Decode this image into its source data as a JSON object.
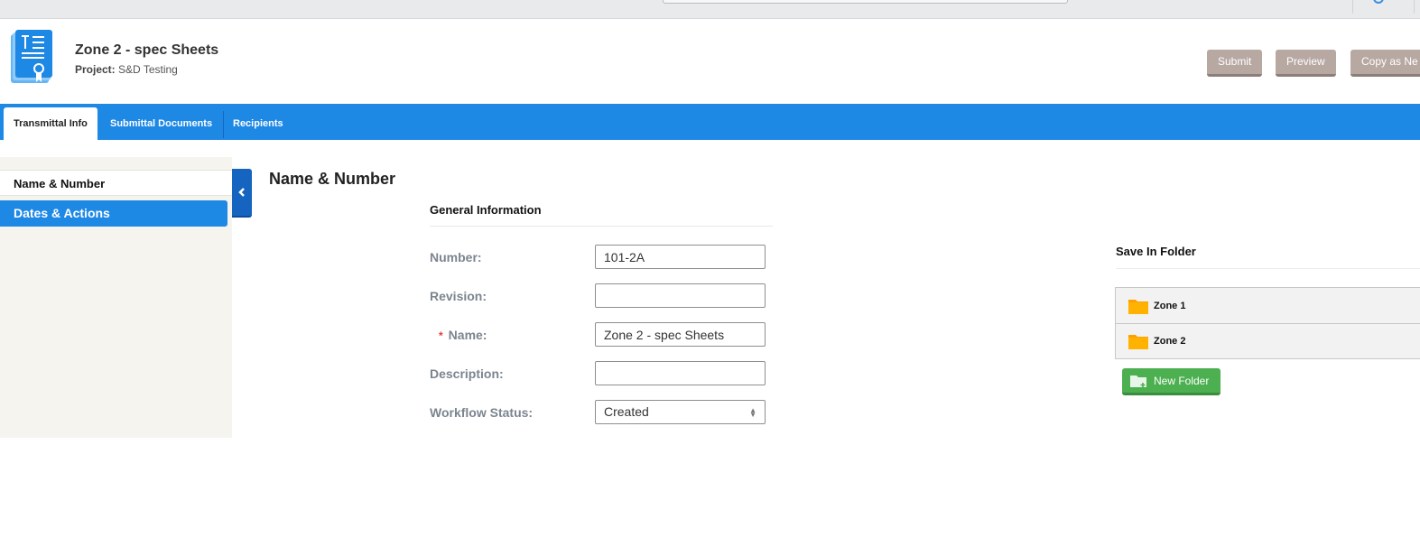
{
  "header": {
    "title": "Zone 2 - spec Sheets",
    "project_label": "Project:",
    "project_value": "S&D Testing",
    "buttons": {
      "submit": "Submit",
      "preview": "Preview",
      "copy": "Copy as Ne"
    }
  },
  "tabs": [
    {
      "label": "Transmittal Info",
      "active": true
    },
    {
      "label": "Submittal Documents",
      "active": false
    },
    {
      "label": "Recipients",
      "active": false
    }
  ],
  "sidebar": {
    "items": [
      {
        "label": "Name & Number",
        "active": false
      },
      {
        "label": "Dates & Actions",
        "active": true
      }
    ]
  },
  "main": {
    "section_title": "Name & Number",
    "general_info_title": "General Information",
    "fields": [
      {
        "label": "Number:",
        "value": "101-2A",
        "required": false
      },
      {
        "label": "Revision:",
        "value": "",
        "required": false
      },
      {
        "label": "Name:",
        "value": "Zone 2 - spec Sheets",
        "required": true,
        "required_marker": "*"
      },
      {
        "label": "Description:",
        "value": "",
        "required": false
      },
      {
        "label": "Workflow Status:",
        "value": "Created",
        "type": "select"
      }
    ]
  },
  "folders": {
    "title": "Save In Folder",
    "items": [
      {
        "label": "Zone 1"
      },
      {
        "label": "Zone 2"
      }
    ],
    "new_folder_label": "New Folder"
  },
  "colors": {
    "primary": "#1e88e5",
    "primary_dark": "#1565c0",
    "header_button": "#b8a8a2",
    "success": "#4caf50",
    "folder": "#ffa000",
    "required": "#e53935"
  }
}
